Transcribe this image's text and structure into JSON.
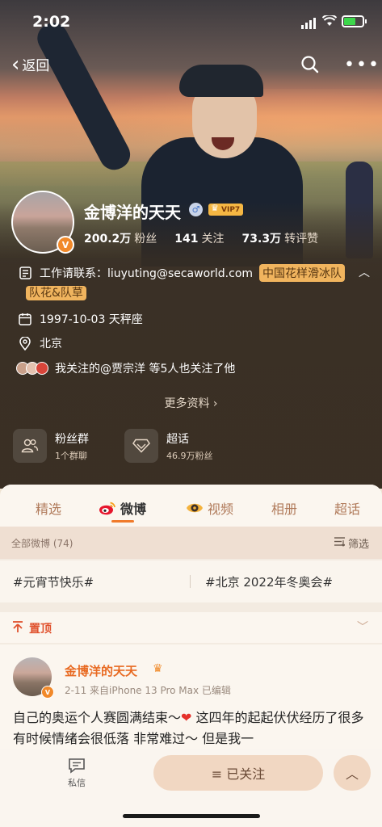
{
  "status_bar": {
    "time": "2:02"
  },
  "nav": {
    "back_label": "返回"
  },
  "profile": {
    "name": "金博洋的天天",
    "vip": "VIP7",
    "followers_count": "200.2万",
    "followers_label": "粉丝",
    "following_count": "141",
    "following_label": "关注",
    "reposts_count": "73.3万",
    "reposts_label": "转评赞",
    "work_contact": "工作请联系：liuyuting@secaworld.com",
    "work_tag_1": "中国花样滑冰队",
    "work_tag_2": "队花&队草",
    "birthday": "1997-10-03 天秤座",
    "location": "北京",
    "mutual_follow": "我关注的@贾宗洋 等5人也关注了他",
    "more_info": "更多资料 ›"
  },
  "cards": [
    {
      "title": "粉丝群",
      "subtitle": "1个群聊",
      "icon": "people-icon"
    },
    {
      "title": "超话",
      "subtitle": "46.9万粉丝",
      "icon": "diamond-icon"
    }
  ],
  "tabs": [
    {
      "label": "精选"
    },
    {
      "label": "微博",
      "active": true
    },
    {
      "label": "视频"
    },
    {
      "label": "相册"
    },
    {
      "label": "超话"
    }
  ],
  "filter": {
    "all_label": "全部微博 (74)",
    "filter_label": "筛选"
  },
  "topics": [
    "#元宵节快乐#",
    "#北京 2022年冬奥会#"
  ],
  "pinned": {
    "label": "置顶"
  },
  "post": {
    "author": "金博洋的天天",
    "meta": "2-11  来自iPhone 13 Pro Max  已编辑",
    "text_part1": "自己的奥运个人赛圆满结束～",
    "text_part2": " 这四年的起起伏伏经历了很多 有时候情绪会很低落 非常难过～ 但是我一"
  },
  "bottom_bar": {
    "dm_label": "私信",
    "follow_label": "≡  已关注",
    "up_label": "︿"
  },
  "colors": {
    "accent": "#f07a2a",
    "highlight": "#f0b45e",
    "pin_red": "#e0522e"
  }
}
